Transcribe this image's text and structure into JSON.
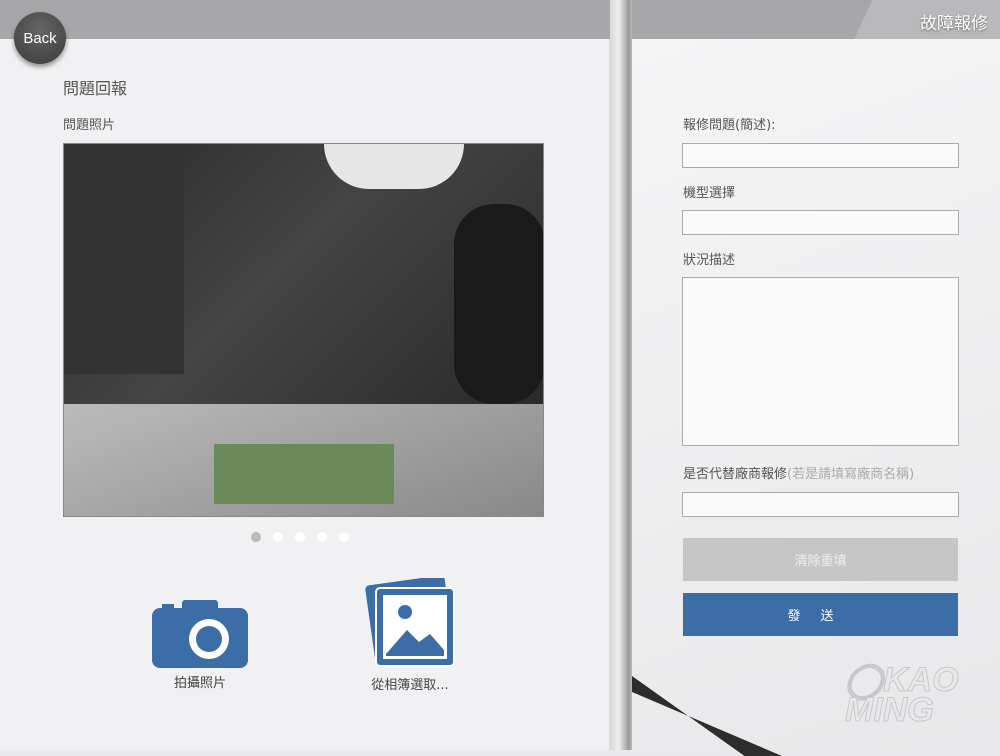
{
  "header": {
    "title": "故障報修",
    "back_label": "Back"
  },
  "left": {
    "heading": "問題回報",
    "photo_label": "問題照片",
    "carousel": {
      "count": 5,
      "active": 0
    },
    "camera_label": "拍攝照片",
    "album_label": "從相簿選取..."
  },
  "form": {
    "issue_label": "報修問題(簡述):",
    "issue_value": "",
    "model_label": "機型選擇",
    "model_value": "",
    "desc_label": "狀況描述",
    "desc_value": "",
    "vendor_label": "是否代替廠商報修",
    "vendor_hint": "(若是請填寫廠商名稱)",
    "vendor_value": "",
    "clear_label": "清除重填",
    "send_label": "發送"
  },
  "logo": {
    "text": "KAO MING",
    "badge": "KM"
  },
  "colors": {
    "accent": "#3c6da6",
    "disabled": "#c6c6c7"
  }
}
